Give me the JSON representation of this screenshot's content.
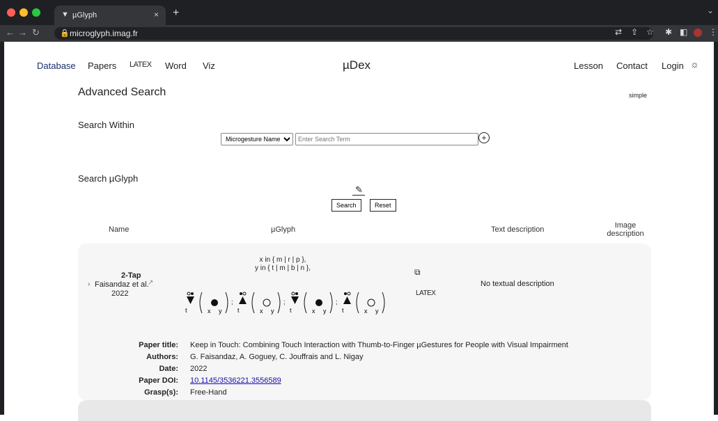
{
  "browser": {
    "tab_title": "µGlyph",
    "url": "microglyph.imag.fr",
    "new_tab": "+",
    "tab_close": "×"
  },
  "nav": {
    "left": [
      "Database",
      "Papers",
      "LATEX",
      "Word",
      "Viz"
    ],
    "brand": "µDex",
    "right": [
      "Lesson",
      "Contact",
      "Login"
    ]
  },
  "page": {
    "title": "Advanced Search",
    "simple_link": "simple",
    "search_within_heading": "Search Within",
    "search_within_select": "Microgesture Name",
    "search_input_placeholder": "Enter Search Term",
    "search_glyph_heading": "Search µGlyph",
    "search_button": "Search",
    "reset_button": "Reset"
  },
  "table": {
    "headers": [
      "Name",
      "µGlyph",
      "Text description",
      "Image description"
    ]
  },
  "result": {
    "name": "2-Tap",
    "authors_short": "Faisandaz et al.",
    "year": "2022",
    "formula_line1": "x in { m | r | p },",
    "formula_line2": "y in { t | m | b | n },",
    "latex_label": "LATEX",
    "text_description": "No textual description",
    "details": [
      {
        "label": "Paper title:",
        "value": "Keep in Touch: Combining Touch Interaction with Thumb-to-Finger µGestures for People with Visual Impairment"
      },
      {
        "label": "Authors:",
        "value": "G. Faisandaz, A. Goguey, C. Jouffrais and L. Nigay"
      },
      {
        "label": "Date:",
        "value": "2022"
      },
      {
        "label": "Paper DOI:",
        "value": "10.1145/3536221.3556589"
      },
      {
        "label": "Grasp(s):",
        "value": "Free-Hand"
      }
    ]
  },
  "colors": {
    "nav_active": "#1b2f6b",
    "card_bg": "#f6f6f6",
    "link": "#1a0dab"
  }
}
